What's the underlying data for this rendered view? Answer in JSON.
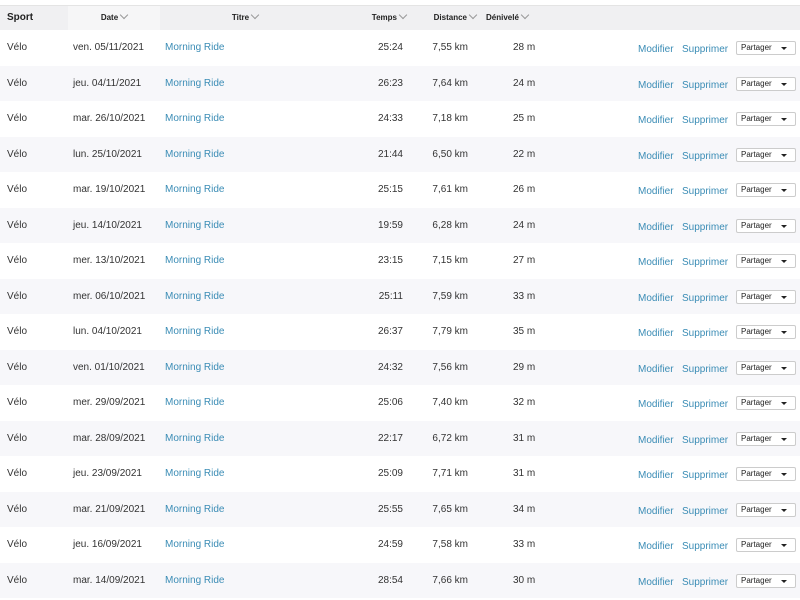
{
  "headers": {
    "sport": "Sport",
    "date": "Date",
    "title": "Titre",
    "time": "Temps",
    "distance": "Distance",
    "elevation": "Dénivelé"
  },
  "actions": {
    "edit": "Modifier",
    "delete": "Supprimer",
    "share": "Partager"
  },
  "rows": [
    {
      "sport": "Vélo",
      "date": "ven. 05/11/2021",
      "title": "Morning Ride",
      "time": "25:24",
      "distance": "7,55 km",
      "elevation": "28 m"
    },
    {
      "sport": "Vélo",
      "date": "jeu. 04/11/2021",
      "title": "Morning Ride",
      "time": "26:23",
      "distance": "7,64 km",
      "elevation": "24 m"
    },
    {
      "sport": "Vélo",
      "date": "mar. 26/10/2021",
      "title": "Morning Ride",
      "time": "24:33",
      "distance": "7,18 km",
      "elevation": "25 m"
    },
    {
      "sport": "Vélo",
      "date": "lun. 25/10/2021",
      "title": "Morning Ride",
      "time": "21:44",
      "distance": "6,50 km",
      "elevation": "22 m"
    },
    {
      "sport": "Vélo",
      "date": "mar. 19/10/2021",
      "title": "Morning Ride",
      "time": "25:15",
      "distance": "7,61 km",
      "elevation": "26 m"
    },
    {
      "sport": "Vélo",
      "date": "jeu. 14/10/2021",
      "title": "Morning Ride",
      "time": "19:59",
      "distance": "6,28 km",
      "elevation": "24 m"
    },
    {
      "sport": "Vélo",
      "date": "mer. 13/10/2021",
      "title": "Morning Ride",
      "time": "23:15",
      "distance": "7,15 km",
      "elevation": "27 m"
    },
    {
      "sport": "Vélo",
      "date": "mer. 06/10/2021",
      "title": "Morning Ride",
      "time": "25:11",
      "distance": "7,59 km",
      "elevation": "33 m"
    },
    {
      "sport": "Vélo",
      "date": "lun. 04/10/2021",
      "title": "Morning Ride",
      "time": "26:37",
      "distance": "7,79 km",
      "elevation": "35 m"
    },
    {
      "sport": "Vélo",
      "date": "ven. 01/10/2021",
      "title": "Morning Ride",
      "time": "24:32",
      "distance": "7,56 km",
      "elevation": "29 m"
    },
    {
      "sport": "Vélo",
      "date": "mer. 29/09/2021",
      "title": "Morning Ride",
      "time": "25:06",
      "distance": "7,40 km",
      "elevation": "32 m"
    },
    {
      "sport": "Vélo",
      "date": "mar. 28/09/2021",
      "title": "Morning Ride",
      "time": "22:17",
      "distance": "6,72 km",
      "elevation": "31 m"
    },
    {
      "sport": "Vélo",
      "date": "jeu. 23/09/2021",
      "title": "Morning Ride",
      "time": "25:09",
      "distance": "7,71 km",
      "elevation": "31 m"
    },
    {
      "sport": "Vélo",
      "date": "mar. 21/09/2021",
      "title": "Morning Ride",
      "time": "25:55",
      "distance": "7,65 km",
      "elevation": "34 m"
    },
    {
      "sport": "Vélo",
      "date": "jeu. 16/09/2021",
      "title": "Morning Ride",
      "time": "24:59",
      "distance": "7,58 km",
      "elevation": "33 m"
    },
    {
      "sport": "Vélo",
      "date": "mar. 14/09/2021",
      "title": "Morning Ride",
      "time": "28:54",
      "distance": "7,66 km",
      "elevation": "30 m"
    }
  ]
}
